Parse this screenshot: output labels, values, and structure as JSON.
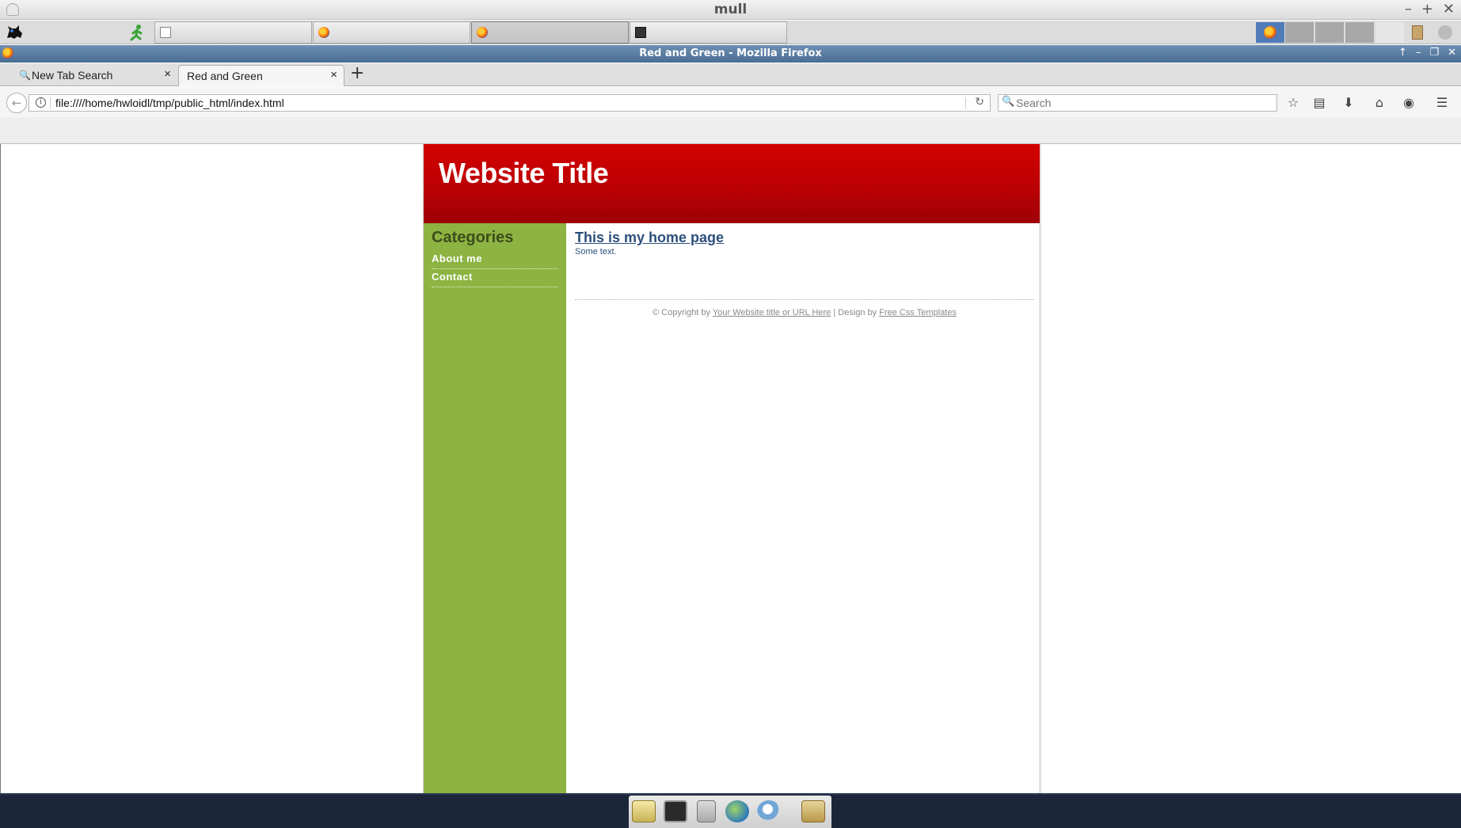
{
  "window": {
    "outer_title": "mull",
    "controls": [
      "–",
      "+",
      "✕"
    ]
  },
  "taskbar": {
    "launchers": [
      "cat-icon",
      "running-man-icon"
    ],
    "tasks": [
      {
        "icon": "page-icon",
        "label": ""
      },
      {
        "icon": "firefox-icon",
        "label": ""
      },
      {
        "icon": "firefox-icon",
        "label": ""
      },
      {
        "icon": "terminal-icon",
        "label": ""
      }
    ],
    "tray": [
      "firefox-icon",
      "workspace-2",
      "workspace-3",
      "workspace-4",
      "workspace-5",
      "clipboard-icon",
      "power-icon"
    ]
  },
  "firefox": {
    "window_title": "Red and Green - Mozilla Firefox",
    "tabs": [
      {
        "label": "New Tab Search",
        "icon": "search-icon",
        "selected": false
      },
      {
        "label": "Red and Green",
        "icon": "",
        "selected": true
      }
    ],
    "new_tab_label": "+",
    "url": "file:////home/hwloidl/tmp/public_html/index.html",
    "search_placeholder": "Search"
  },
  "site": {
    "title": "Website Title",
    "sidebar_heading": "Categories",
    "links": [
      "About me",
      "Contact"
    ],
    "heading": "This is my home page",
    "body_text": "Some text.",
    "footer": {
      "prefix": "© Copyright by ",
      "link1": "Your Website title or URL Here",
      "middle": " | Design by ",
      "link2": "Free Css Templates"
    }
  },
  "dock": {
    "items": [
      "notes-icon",
      "terminal-icon",
      "file-cabinet-icon",
      "globe-icon",
      "magnifier-icon",
      "folder-icon"
    ]
  },
  "colors": {
    "header_red": "#c00000",
    "sidebar_green": "#8db442",
    "heading_blue": "#2c4f7b",
    "dock_bg": "#1b2639"
  }
}
